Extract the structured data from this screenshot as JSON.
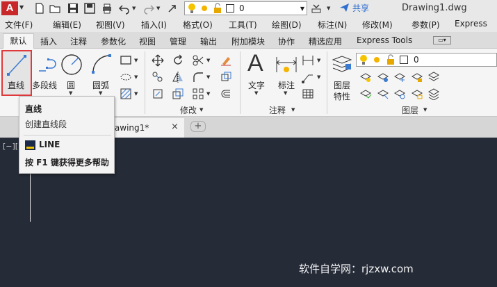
{
  "title": {
    "layer_value": "0",
    "share_label": "共享",
    "document_name": "Drawing1.dwg"
  },
  "menu": [
    "文件(F)",
    "编辑(E)",
    "视图(V)",
    "插入(I)",
    "格式(O)",
    "工具(T)",
    "绘图(D)",
    "标注(N)",
    "修改(M)",
    "参数(P)",
    "Express"
  ],
  "tabs": [
    "默认",
    "插入",
    "注释",
    "参数化",
    "视图",
    "管理",
    "输出",
    "附加模块",
    "协作",
    "精选应用",
    "Express Tools"
  ],
  "ribbon": {
    "line_label": "直线",
    "polyline_label": "多段线",
    "circle_label": "圆",
    "arc_label": "圆弧",
    "text_label": "文字",
    "dimension_label": "标注",
    "layer_props_label_1": "图层",
    "layer_props_label_2": "特性",
    "layer_value": "0",
    "panel_modify": "修改",
    "panel_annotation": "注释",
    "panel_layers": "图层"
  },
  "doc_tabs": {
    "active_tab_label": "rawing1*",
    "close_symbol": "×",
    "new_tab_symbol": "+"
  },
  "canvas": {
    "view_control": "[−][",
    "watermark": "软件自学网：rjzxw.com"
  },
  "tooltip": {
    "title": "直线",
    "description": "创建直线段",
    "command": "LINE",
    "help": "按 F1 键获得更多帮助"
  },
  "colors": {
    "accent_red": "#c8282a",
    "highlight_border": "#e0393b",
    "canvas_bg": "#252b37",
    "share_blue": "#2f6fd0"
  }
}
